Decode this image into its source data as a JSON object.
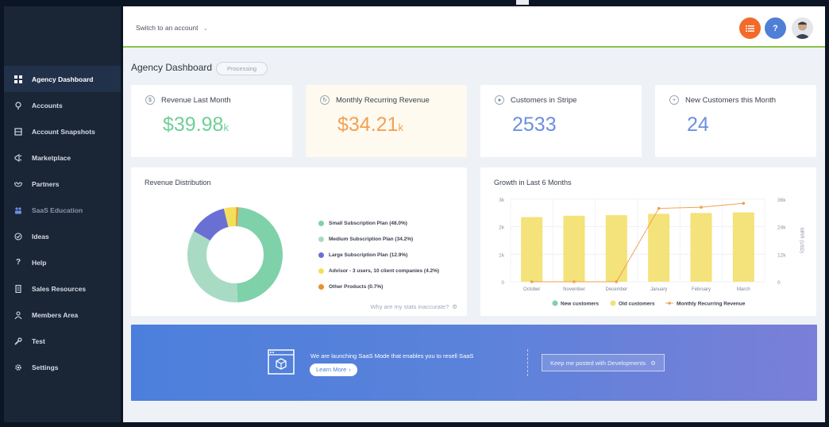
{
  "topbar": {
    "switch_label": "Switch to an account",
    "help_label": "?"
  },
  "sidebar": {
    "items": [
      {
        "label": "Agency Dashboard",
        "icon": "grid-icon"
      },
      {
        "label": "Accounts",
        "icon": "location-pin-icon"
      },
      {
        "label": "Account Snapshots",
        "icon": "snapshot-icon"
      },
      {
        "label": "Marketplace",
        "icon": "megaphone-icon"
      },
      {
        "label": "Partners",
        "icon": "handshake-icon"
      },
      {
        "label": "SaaS Education",
        "icon": "people-icon"
      },
      {
        "label": "Ideas",
        "icon": "check-circle-icon"
      },
      {
        "label": "Help",
        "icon": "question-icon"
      },
      {
        "label": "Sales Resources",
        "icon": "document-icon"
      },
      {
        "label": "Members Area",
        "icon": "members-icon"
      },
      {
        "label": "Test",
        "icon": "wrench-icon"
      },
      {
        "label": "Settings",
        "icon": "gear-icon"
      }
    ]
  },
  "page": {
    "title": "Agency Dashboard",
    "status_badge": "Processing"
  },
  "stats": [
    {
      "label": "Revenue Last Month",
      "value": "$39.98",
      "unit": "k",
      "color": "#6fcf97"
    },
    {
      "label": "Monthly Recurring Revenue",
      "value": "$34.21",
      "unit": "k",
      "color": "#f2a154"
    },
    {
      "label": "Customers in Stripe",
      "value": "2533",
      "unit": "",
      "color": "#6c8fe0"
    },
    {
      "label": "New Customers this Month",
      "value": "24",
      "unit": "",
      "color": "#6c8fe0"
    }
  ],
  "revenue_distribution": {
    "title": "Revenue Distribution",
    "stats_link": "Why are my stats inaccurate?",
    "legend": [
      {
        "label": "Small Subscription Plan (48.0%)",
        "color": "#7fd1aa"
      },
      {
        "label": "Medium Subscription Plan (34.2%)",
        "color": "#a9dbc4"
      },
      {
        "label": "Large Subscription Plan (12.9%)",
        "color": "#6a6fd4"
      },
      {
        "label": "Advisor - 3 users, 10 client companies (4.2%)",
        "color": "#f2e05c"
      },
      {
        "label": "Other Products (0.7%)",
        "color": "#f08c2e"
      }
    ]
  },
  "growth": {
    "title": "Growth in Last 6 Months",
    "ylabel_right": "MRR (USD)",
    "legend": [
      {
        "label": "New customers",
        "color": "#7fd1aa"
      },
      {
        "label": "Old customers",
        "color": "#f2e07a"
      },
      {
        "label": "Monthly Recurring Revenue",
        "color": "#f0a04b"
      }
    ]
  },
  "banner": {
    "text": "We are launching SaaS Mode that enables you to resell SaaS",
    "button_label": "Learn More",
    "cta_label": "Keep me posted with Developments"
  },
  "chart_data": [
    {
      "type": "pie",
      "title": "Revenue Distribution",
      "labels": [
        "Small Subscription Plan",
        "Medium Subscription Plan",
        "Large Subscription Plan",
        "Advisor - 3 users, 10 client companies",
        "Other Products"
      ],
      "values": [
        48.0,
        34.2,
        12.9,
        4.2,
        0.7
      ]
    },
    {
      "type": "bar",
      "title": "Growth in Last 6 Months",
      "categories": [
        "October",
        "November",
        "December",
        "January",
        "February",
        "March"
      ],
      "yticks_left": [
        "0",
        "1k",
        "2k",
        "3k"
      ],
      "yticks_right": [
        "0",
        "12k",
        "24k",
        "36k"
      ],
      "ylim_left": [
        0,
        3000
      ],
      "ylim_right": [
        0,
        36000
      ],
      "ylabel_right": "MRR (USD)",
      "series": [
        {
          "name": "New customers",
          "values": [
            0,
            0,
            0,
            0,
            0,
            0
          ]
        },
        {
          "name": "Old customers",
          "values": [
            2350,
            2400,
            2420,
            2470,
            2500,
            2520
          ]
        },
        {
          "name": "Monthly Recurring Revenue",
          "type": "line",
          "axis": "right",
          "values": [
            0,
            0,
            0,
            32000,
            32500,
            34210
          ]
        }
      ]
    }
  ]
}
